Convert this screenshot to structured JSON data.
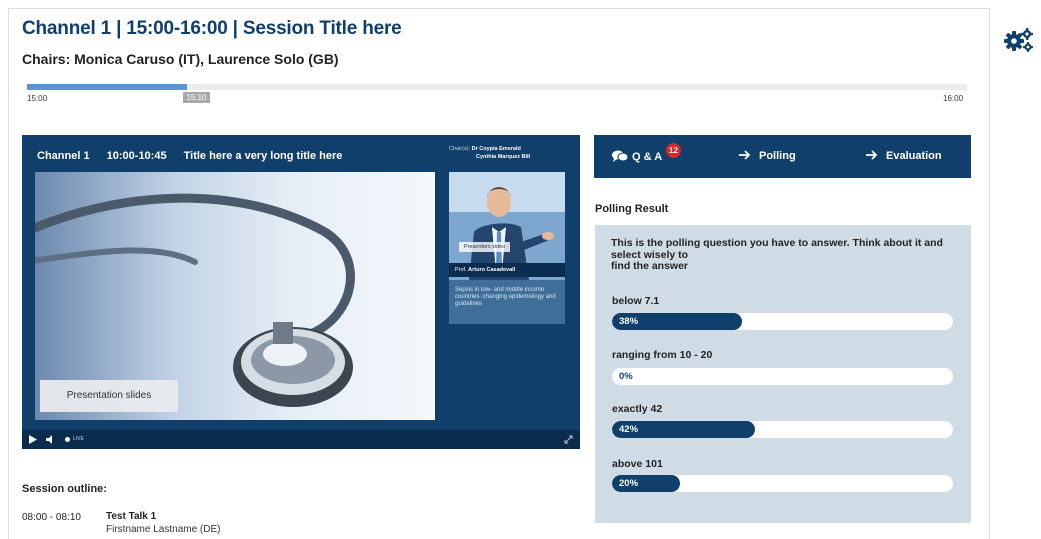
{
  "header": {
    "title": "Channel 1 | 15:00-16:00 | Session Title here",
    "chairs": "Chairs: Monica Caruso (IT), Laurence Solo (GB)"
  },
  "timeline": {
    "start": "15:00",
    "end": "16:00",
    "current": "15:10",
    "progress": 0.17
  },
  "player": {
    "channel": "Channel 1",
    "time": "10:00-10:45",
    "talk_title": "Title here a very long title here",
    "chairs_label": "Chair(s):",
    "chair_1": "Dr Coypia Emerald",
    "chair_2": "Cynthia Marquez Bill",
    "slides_button": "Presentation slides",
    "presenter_video_label": "Presenters video",
    "presenter_prefix": "Prof.",
    "presenter_name": "Arturo Casadevall",
    "talk_description": "Sepsis in low- and middle income countries: changing epidemiology and guidelines",
    "live_label": "LIVE",
    "icons": {
      "play": "play-icon",
      "volume": "volume-icon",
      "fullscreen": "fullscreen-icon"
    }
  },
  "outline": {
    "title": "Session outline:",
    "items": [
      {
        "time": "08:00 - 08:10",
        "talk": "Test Talk 1",
        "speaker": "Firstname Lastname (DE)"
      }
    ]
  },
  "tabs": {
    "qa_label": "Q & A",
    "qa_badge": "12",
    "polling_label": "Polling",
    "evaluation_label": "Evaluation"
  },
  "polling": {
    "title": "Polling Result",
    "question_line_1": "This is the polling question you have to answer. Think about it and",
    "question_line_2": "select wisely to",
    "question_line_3": "find the answer",
    "options": [
      {
        "label": "below 7.1",
        "percent_text": "38%",
        "percent": 38
      },
      {
        "label": "ranging from 10 - 20",
        "percent_text": "0%",
        "percent": 0
      },
      {
        "label": "exactly 42",
        "percent_text": "42%",
        "percent": 42
      },
      {
        "label": "above 101",
        "percent_text": "20%",
        "percent": 20
      }
    ]
  },
  "colors": {
    "brand_navy": "#0f3f6a",
    "timeline_blue": "#5b95d2",
    "badge_red": "#d9252b",
    "poll_bg": "#d0dce5"
  },
  "settings_icon": "gears-icon"
}
